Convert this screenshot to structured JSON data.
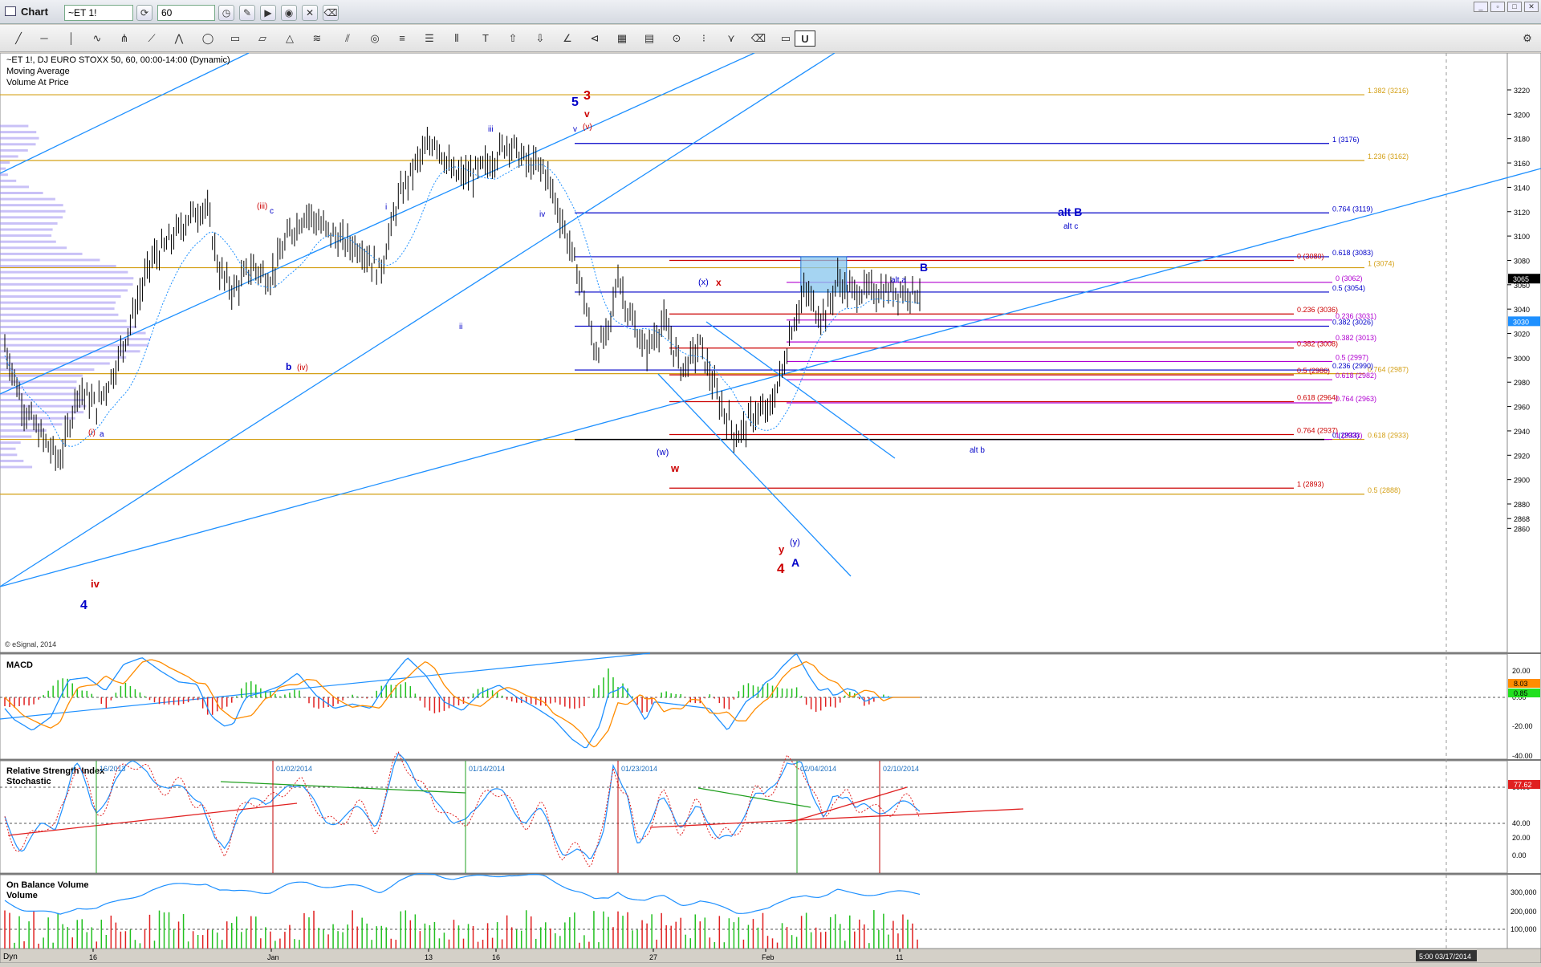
{
  "window": {
    "title": "Chart",
    "symbol_input": "~ET 1!",
    "interval_input": "60",
    "footer_time": "5:00 03/17/2014",
    "footer_left": "Dyn"
  },
  "colors": {
    "blue": "#1e90ff",
    "navy": "#0000c8",
    "red": "#cc0000",
    "gold": "#d4a017",
    "purple": "#b000d0",
    "price_black": "#000"
  },
  "icons": [
    "chart-window-icon",
    "refresh-icon",
    "cursor-icon",
    "draw-icon",
    "play-icon",
    "alert-icon",
    "tool-icon"
  ],
  "header": {
    "line1": "~ET 1!, DJ EURO STOXX 50, 60, 00:00-14:00 (Dynamic)",
    "line2": "Moving Average",
    "line3": "Volume At Price",
    "copyright": "© eSignal, 2014"
  },
  "price_axis": {
    "ticks": [
      "3220",
      "3200",
      "3180",
      "3160",
      "3140",
      "3120",
      "3100",
      "3080",
      "3060",
      "3040",
      "3020",
      "3000",
      "2980",
      "2960",
      "2940",
      "2920",
      "2900",
      "2880",
      "2868",
      "2860"
    ],
    "last_price": "3065",
    "ma_price": "3030"
  },
  "date_axis": [
    "16",
    "Jan",
    "13",
    "16",
    "27",
    "Feb",
    "11"
  ],
  "fib_labels": {
    "gold": [
      {
        "t": "1.382 (3216)",
        "y": 3216
      },
      {
        "t": "1.236 (3162)",
        "y": 3162
      },
      {
        "t": "1 (3074)",
        "y": 3074
      },
      {
        "t": "0.764 (2987)",
        "y": 2987
      },
      {
        "t": "0.618 (2933)",
        "y": 2933
      },
      {
        "t": "0.5 (2888)",
        "y": 2888
      }
    ],
    "navy": [
      {
        "t": "1 (3176)",
        "y": 3176
      },
      {
        "t": "0.764 (3119)",
        "y": 3119
      },
      {
        "t": "0.618 (3083)",
        "y": 3083
      },
      {
        "t": "0.5 (3054)",
        "y": 3054
      },
      {
        "t": "0.382 (3026)",
        "y": 3026
      },
      {
        "t": "0.236 (2990)",
        "y": 2990
      },
      {
        "t": "0 (2933)",
        "y": 2933
      }
    ],
    "red": [
      {
        "t": "0 (3080)",
        "y": 3080
      },
      {
        "t": "0.236 (3036)",
        "y": 3036
      },
      {
        "t": "0.382 (3008)",
        "y": 3008
      },
      {
        "t": "0.5 (2986)",
        "y": 2986
      },
      {
        "t": "0.618 (2964)",
        "y": 2964
      },
      {
        "t": "0.764 (2937)",
        "y": 2937
      },
      {
        "t": "1 (2893)",
        "y": 2893
      }
    ],
    "purple": [
      {
        "t": "0 (3062)",
        "y": 3062
      },
      {
        "t": "0.236 (3031)",
        "y": 3031
      },
      {
        "t": "0.382 (3013)",
        "y": 3013
      },
      {
        "t": "0.5 (2997)",
        "y": 2997
      },
      {
        "t": "0.618 (2982)",
        "y": 2982
      },
      {
        "t": "0.764 (2963)",
        "y": 2963
      },
      {
        "t": "1 (2933)",
        "y": 2933
      }
    ]
  },
  "wave_labels": {
    "blue_big": [
      "4",
      "5",
      "B",
      "alt B",
      "A"
    ],
    "red_big": [
      "3",
      "4",
      "iv",
      "w",
      "x",
      "y",
      "v"
    ],
    "small": [
      "(i)",
      "a",
      "b",
      "c",
      "(iii)",
      "(iv)",
      "(v)",
      "i",
      "ii",
      "iii",
      "iv",
      "v",
      "(x)",
      "(w)",
      "(y)",
      "alt a",
      "alt c",
      "alt b"
    ]
  },
  "macd": {
    "title": "MACD",
    "ticks": [
      "20.00",
      "0.00",
      "-20.00",
      "-40.00"
    ],
    "val1": "8.03",
    "val2": "0.85"
  },
  "rsi": {
    "title": "Relative Strength Index",
    "title2": "Stochastic",
    "ticks": [
      "80.00",
      "40.00",
      "20.00",
      "0.00"
    ],
    "val": "77.62",
    "dates": [
      "16/2013",
      "01/02/2014",
      "01/14/2014",
      "01/23/2014",
      "02/04/2014",
      "02/10/2014"
    ]
  },
  "obv": {
    "title": "On Balance Volume",
    "title2": "Volume",
    "ticks": [
      "300,000",
      "200,000",
      "100,000"
    ]
  },
  "chart_data": {
    "type": "line",
    "title": "~ET 1!, DJ EURO STOXX 50, 60, 00:00-14:00 (Dynamic)",
    "ylim": [
      2860,
      3235
    ],
    "x_ticks": [
      "16",
      "Jan",
      "13",
      "16",
      "27",
      "Feb",
      "11"
    ],
    "price_path": [
      [
        0,
        3010
      ],
      [
        0.02,
        2960
      ],
      [
        0.04,
        2935
      ],
      [
        0.06,
        2915
      ],
      [
        0.08,
        2975
      ],
      [
        0.1,
        2960
      ],
      [
        0.12,
        2990
      ],
      [
        0.14,
        3035
      ],
      [
        0.16,
        3080
      ],
      [
        0.18,
        3095
      ],
      [
        0.2,
        3115
      ],
      [
        0.22,
        3125
      ],
      [
        0.235,
        3070
      ],
      [
        0.25,
        3055
      ],
      [
        0.27,
        3075
      ],
      [
        0.29,
        3065
      ],
      [
        0.31,
        3100
      ],
      [
        0.33,
        3120
      ],
      [
        0.35,
        3105
      ],
      [
        0.37,
        3095
      ],
      [
        0.39,
        3090
      ],
      [
        0.41,
        3070
      ],
      [
        0.43,
        3130
      ],
      [
        0.45,
        3160
      ],
      [
        0.47,
        3180
      ],
      [
        0.49,
        3150
      ],
      [
        0.51,
        3150
      ],
      [
        0.53,
        3160
      ],
      [
        0.55,
        3178
      ],
      [
        0.57,
        3160
      ],
      [
        0.59,
        3155
      ],
      [
        0.61,
        3110
      ],
      [
        0.63,
        3060
      ],
      [
        0.645,
        3005
      ],
      [
        0.66,
        3020
      ],
      [
        0.67,
        3070
      ],
      [
        0.68,
        3040
      ],
      [
        0.7,
        3005
      ],
      [
        0.72,
        3030
      ],
      [
        0.74,
        2990
      ],
      [
        0.76,
        3010
      ],
      [
        0.78,
        2965
      ],
      [
        0.8,
        2935
      ],
      [
        0.82,
        2955
      ],
      [
        0.835,
        2955
      ],
      [
        0.85,
        2990
      ],
      [
        0.86,
        3025
      ],
      [
        0.875,
        3055
      ],
      [
        0.89,
        3035
      ],
      [
        0.9,
        3040
      ],
      [
        0.91,
        3065
      ],
      [
        0.92,
        3055
      ]
    ],
    "zone": {
      "x0": 0.87,
      "x1": 0.92,
      "y0": 3054,
      "y1": 3083
    }
  }
}
